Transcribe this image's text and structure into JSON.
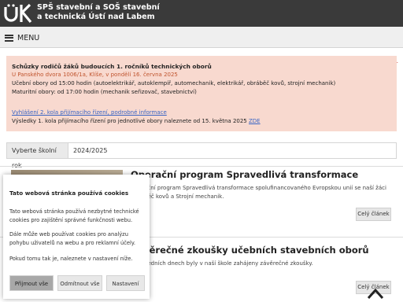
{
  "header": {
    "school_line1": "SPŠ stavební a SOŠ stavební",
    "school_line2": "a technická Ústí nad Labem",
    "logo_icon": "school-logo-icon",
    "background": "#3a3a3a"
  },
  "nav": {
    "menu_label": "MENU",
    "menu_icon": "hamburger-icon",
    "building_icon": "building-logo-icon"
  },
  "notice": {
    "background": "#f8d9cf",
    "title": "Schůzky rodičů žáků budoucích 1. ročníků technických oborů",
    "location": "U Panského dvora 1006/1a, Klíše, v pondělí 16. června 2025",
    "line1": "Učební obory od 15:00 hodin (autoelektrikář, autoklempíř, automechanik, elektrikář, obráběč kovů, strojní mechanik)",
    "line2": "Maturitní obory: od 17:00 hodin (mechanik seřizovač, stavebnictví)",
    "link_text": "Vyhlášení 2. kola přijímacího řízení, podrobné informace",
    "results_text": "Výsledky 1. kola přijímacího řízení pro jednotlivé obory naleznete od 15. května 2025",
    "results_link": "ZDE"
  },
  "filter": {
    "label": "Vyberte školní rok",
    "value": "2024/2025"
  },
  "articles": [
    {
      "title": "Operační program Spravedlivá transformace",
      "text": "Operační program Spravedlivá transformace spolufinancovaného Evropskou unií se naší žáci Obráběč kovů a Strojní mechanik.",
      "button": "Celý článek"
    },
    {
      "title": "Závěrečné zkoušky učebních stavebních oborů",
      "text": "V posledních dnech byly v naší škole zahájeny závěrečné zkoušky.",
      "button": "Celý článek"
    }
  ],
  "cookie": {
    "title": "Tato webová stránka používá cookies",
    "p1": "Tato webová stránka používá nezbytné technické cookies pro zajištění správné funkčnosti webu.",
    "p2": "Dále může web používat cookies pro analýzu pohybu uživatelů na webu a pro reklamní účely.",
    "p3": "Pokud tomu tak je, naleznete v nastavení níže.",
    "accept": "Přijmout vše",
    "reject": "Odmítnout vše",
    "settings": "Nastavení"
  },
  "scroll_top_icon": "chevron-up-icon"
}
